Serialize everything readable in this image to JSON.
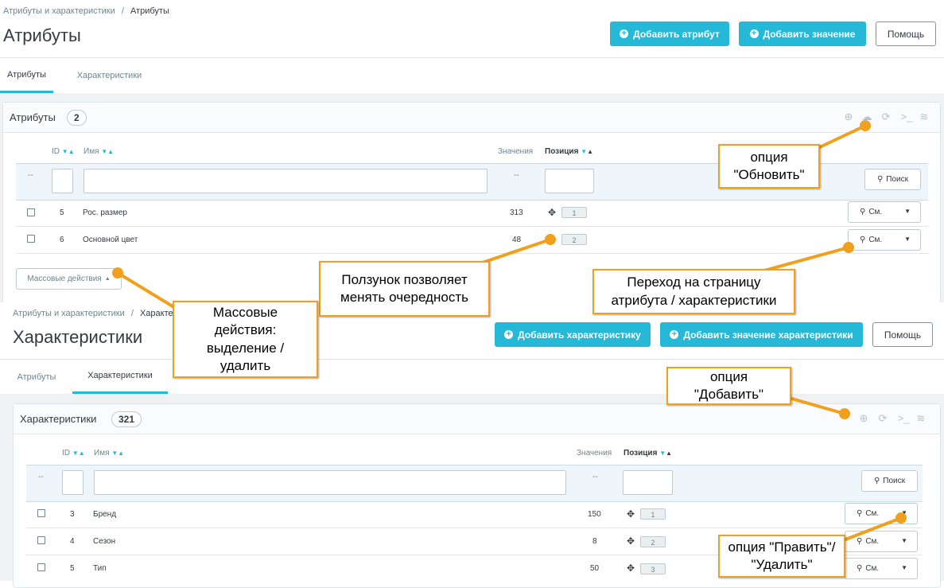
{
  "top": {
    "breadcrumb_parent": "Атрибуты и характеристики",
    "breadcrumb_sep": "/",
    "breadcrumb_current": "Атрибуты",
    "title": "Атрибуты",
    "btn_add_attribute": "Добавить атрибут",
    "btn_add_value": "Добавить значение",
    "btn_help": "Помощь",
    "tabs": [
      "Атрибуты",
      "Характеристики"
    ],
    "panel_title": "Атрибуты",
    "panel_count": "2",
    "columns": {
      "id": "ID",
      "name": "Имя",
      "values": "Значения",
      "position": "Позиция"
    },
    "filter_dash": "--",
    "filter_values_dash": "--",
    "search_label": "Поиск",
    "rows": [
      {
        "id": "5",
        "name": "Рос. размер",
        "values": "313",
        "position": "1",
        "view": "См."
      },
      {
        "id": "6",
        "name": "Основной цвет",
        "values": "48",
        "position": "2",
        "view": "См."
      }
    ],
    "bulk_label": "Массовые действия"
  },
  "bottom": {
    "breadcrumb_parent": "Атрибуты и характеристики",
    "breadcrumb_sep": "/",
    "breadcrumb_current": "Характеристики",
    "title": "Характеристики",
    "btn_add_feature": "Добавить характеристику",
    "btn_add_feature_value": "Добавить значение характеристики",
    "btn_help": "Помощь",
    "tabs": [
      "Атрибуты",
      "Характеристики"
    ],
    "panel_title": "Характеристики",
    "panel_count": "321",
    "columns": {
      "id": "ID",
      "name": "Имя",
      "values": "Значения",
      "position": "Позиция"
    },
    "filter_dash": "--",
    "filter_values_dash": "--",
    "search_label": "Поиск",
    "rows": [
      {
        "id": "3",
        "name": "Бренд",
        "values": "150",
        "position": "1",
        "view": "См."
      },
      {
        "id": "4",
        "name": "Сезон",
        "values": "8",
        "position": "2",
        "view": "См."
      },
      {
        "id": "5",
        "name": "Тип",
        "values": "50",
        "position": "3",
        "view": "См."
      }
    ]
  },
  "callouts": {
    "refresh": "опция\n\"Обновить\"",
    "slider": "Ползунок позволяет\nменять очередность",
    "goto_page": "Переход на страницу\nатрибута / характеристики",
    "bulk": "Массовые\nдействия:\nвыделение /\nудалить",
    "add": "опция\n\"Добавить\"",
    "edit_delete": "опция \"Править\"/\n\"Удалить\""
  },
  "icons": {
    "add": "plus-circle-icon",
    "refresh": "refresh-icon",
    "upload": "cloud-upload-icon",
    "terminal": "terminal-icon",
    "database": "database-icon",
    "search": "search-icon",
    "zoom": "zoom-icon",
    "caret": "caret-down-icon",
    "drag": "drag-handle-icon"
  },
  "colors": {
    "primary": "#25b9d7",
    "callout_border": "#f0a01c",
    "arrow": "#f0a01c"
  }
}
